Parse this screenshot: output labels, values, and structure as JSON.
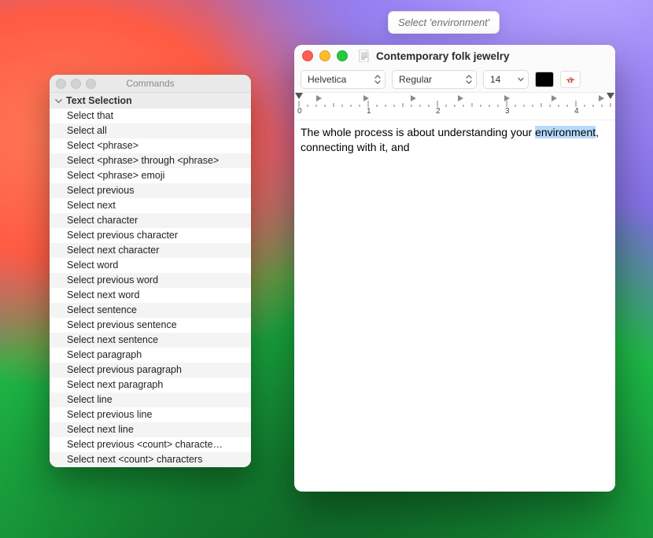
{
  "siri_suggestion": "Select 'environment'",
  "commands_window": {
    "title": "Commands",
    "section_title": "Text Selection",
    "items": [
      "Select that",
      "Select all",
      "Select <phrase>",
      "Select <phrase> through <phrase>",
      "Select <phrase> emoji",
      "Select previous",
      "Select next",
      "Select character",
      "Select previous character",
      "Select next character",
      "Select word",
      "Select previous word",
      "Select next word",
      "Select sentence",
      "Select previous sentence",
      "Select next sentence",
      "Select paragraph",
      "Select previous paragraph",
      "Select next paragraph",
      "Select line",
      "Select previous line",
      "Select next line",
      "Select previous <count> characte…",
      "Select next <count> characters"
    ]
  },
  "editor_window": {
    "title": "Contemporary folk jewelry",
    "toolbar": {
      "font": "Helvetica",
      "style": "Regular",
      "size": "14",
      "text_color": "#000000"
    },
    "ruler": {
      "labels": [
        "0",
        "1",
        "2",
        "3",
        "4"
      ]
    },
    "body": {
      "pre": "The whole process is about understanding your ",
      "highlight": "environment",
      "post": ", connecting with it, and"
    }
  }
}
